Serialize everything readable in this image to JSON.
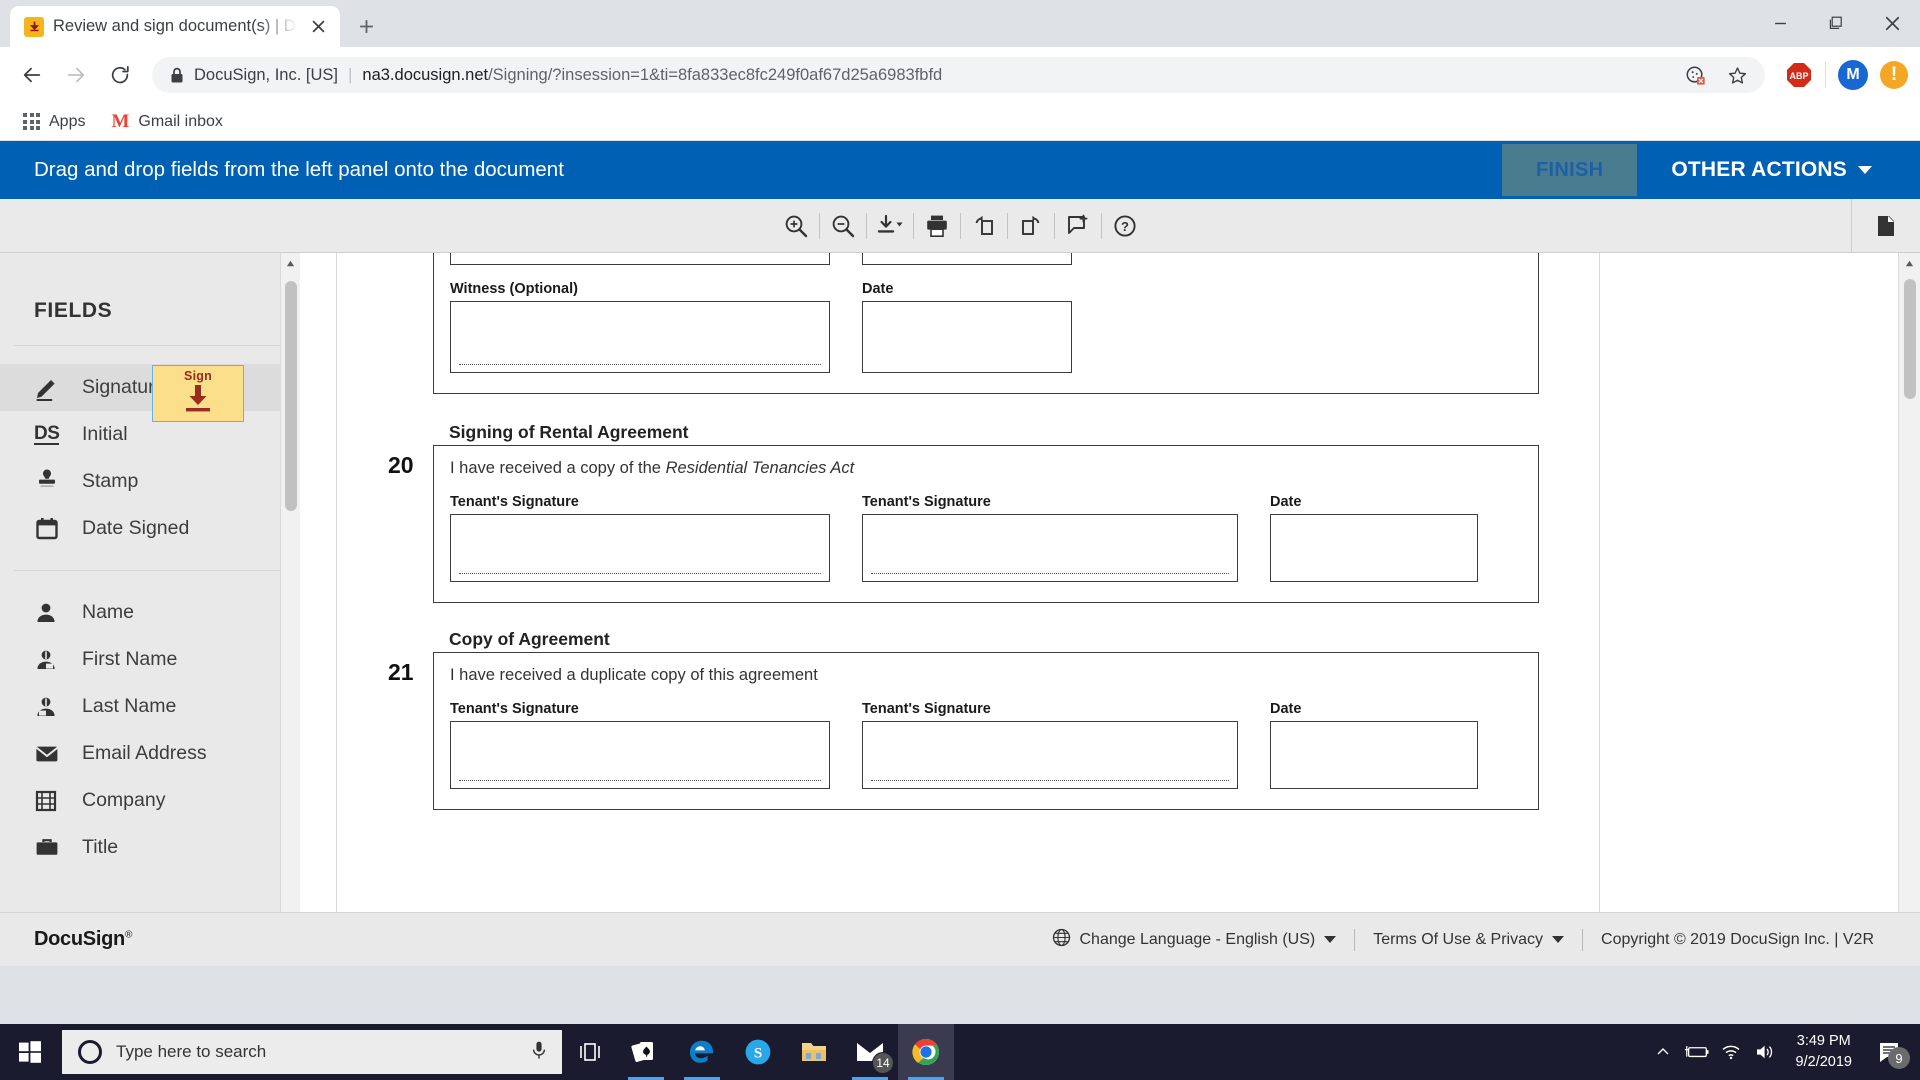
{
  "browser": {
    "tab": {
      "title": "Review and sign document(s) | Do",
      "favicon_name": "docusign-favicon",
      "close_label": "✕",
      "new_tab_label": "+"
    },
    "window_controls": {
      "minimize": "—",
      "restore": "❐",
      "close": "✕"
    },
    "omnibox": {
      "secure_label": "DocuSign, Inc. [US]",
      "separator": "|",
      "host": "na3.docusign.net",
      "path": "/Signing/?insession=1&ti=8fa833ec8fc249f0af67d25a6983fbfd",
      "full_url": "na3.docusign.net/Signing/?insession=1&ti=8fa833ec8fc249f0af67d25a6983fbfd"
    },
    "extensions": {
      "abp_label": "ABP",
      "profile_initial": "M",
      "alert_glyph": "!"
    },
    "bookmarks": [
      {
        "label": "Apps",
        "icon": "apps-grid-icon"
      },
      {
        "label": "Gmail inbox",
        "icon": "gmail-icon"
      }
    ]
  },
  "docusign": {
    "banner": {
      "message": "Drag and drop fields from the left panel onto the document",
      "finish_label": "FINISH",
      "other_actions_label": "OTHER ACTIONS",
      "banner_color": "#0060b4",
      "finish_color": "#4a7c8f"
    },
    "toolbar": [
      {
        "name": "zoom-in-icon",
        "title": "Zoom In"
      },
      {
        "name": "zoom-out-icon",
        "title": "Zoom Out"
      },
      {
        "name": "download-icon",
        "title": "Download"
      },
      {
        "name": "print-icon",
        "title": "Print"
      },
      {
        "name": "rotate-left-icon",
        "title": "Rotate Left"
      },
      {
        "name": "rotate-right-icon",
        "title": "Rotate Right"
      },
      {
        "name": "add-comment-icon",
        "title": "Add Comment"
      },
      {
        "name": "help-icon",
        "title": "Help"
      }
    ],
    "toolbar_right": {
      "name": "page-thumbnails-icon",
      "title": "Toggle Thumbnails"
    },
    "sidebar": {
      "title": "FIELDS",
      "group_one": [
        {
          "label": "Signature",
          "icon": "pen-signature-icon",
          "active": true
        },
        {
          "label": "Initial",
          "icon": "ds-initial-icon",
          "active": false
        },
        {
          "label": "Stamp",
          "icon": "stamp-icon",
          "active": false
        },
        {
          "label": "Date Signed",
          "icon": "calendar-icon",
          "active": false
        }
      ],
      "group_two": [
        {
          "label": "Name",
          "icon": "person-icon",
          "active": false
        },
        {
          "label": "First Name",
          "icon": "person-first-icon",
          "active": false
        },
        {
          "label": "Last Name",
          "icon": "person-last-icon",
          "active": false
        },
        {
          "label": "Email Address",
          "icon": "envelope-icon",
          "active": false
        },
        {
          "label": "Company",
          "icon": "building-icon",
          "active": false
        },
        {
          "label": "Title",
          "icon": "briefcase-icon",
          "active": false
        }
      ],
      "drag_chip": {
        "label": "Sign",
        "icon": "down-arrow-sign-icon",
        "bg_color": "#fbdf8a",
        "accent_color": "#9a2b1e"
      }
    },
    "document": {
      "top_partial": {
        "fields": [
          {
            "label": "Witness (Optional)"
          },
          {
            "label": "Date"
          }
        ]
      },
      "sections": [
        {
          "number": "20",
          "title": "Signing of Rental Agreement",
          "statement_before": "I have received a copy of the ",
          "statement_italic": "Residential Tenancies Act",
          "statement_after": "",
          "fields": [
            {
              "label": "Tenant's Signature",
              "kind": "signature"
            },
            {
              "label": "Tenant's Signature",
              "kind": "signature"
            },
            {
              "label": "Date",
              "kind": "date"
            }
          ]
        },
        {
          "number": "21",
          "title": "Copy of Agreement",
          "statement_before": "I have received a duplicate copy of this agreement",
          "statement_italic": "",
          "statement_after": "",
          "fields": [
            {
              "label": "Tenant's Signature",
              "kind": "signature"
            },
            {
              "label": "Tenant's Signature",
              "kind": "signature"
            },
            {
              "label": "Date",
              "kind": "date"
            }
          ]
        }
      ]
    },
    "footer": {
      "logo": "DocuSign",
      "logo_mark": "®",
      "change_language": "Change Language - English (US)",
      "terms": "Terms Of Use & Privacy",
      "copyright": "Copyright © 2019 DocuSign Inc.  |  V2R"
    }
  },
  "taskbar": {
    "start_icon": "windows-start-icon",
    "search_placeholder": "Type here to search",
    "search_value": "",
    "mic_icon": "microphone-icon",
    "apps": [
      {
        "name": "task-view-icon",
        "label": "Task View",
        "state": ""
      },
      {
        "name": "solitaire-icon",
        "label": "Solitaire",
        "state": "open"
      },
      {
        "name": "edge-icon",
        "label": "Microsoft Edge",
        "state": "open"
      },
      {
        "name": "skype-icon",
        "label": "Skype",
        "state": ""
      },
      {
        "name": "file-explorer-icon",
        "label": "File Explorer",
        "state": ""
      },
      {
        "name": "mail-icon",
        "label": "Mail",
        "state": "open",
        "badge": "14"
      },
      {
        "name": "chrome-icon",
        "label": "Google Chrome",
        "state": "active"
      }
    ],
    "tray": {
      "chevron": "show-hidden-icons",
      "battery": "battery-charging-icon",
      "wifi": "wifi-icon",
      "volume": "volume-icon",
      "time": "3:49 PM",
      "date": "9/2/2019",
      "notification_count": "9"
    }
  }
}
